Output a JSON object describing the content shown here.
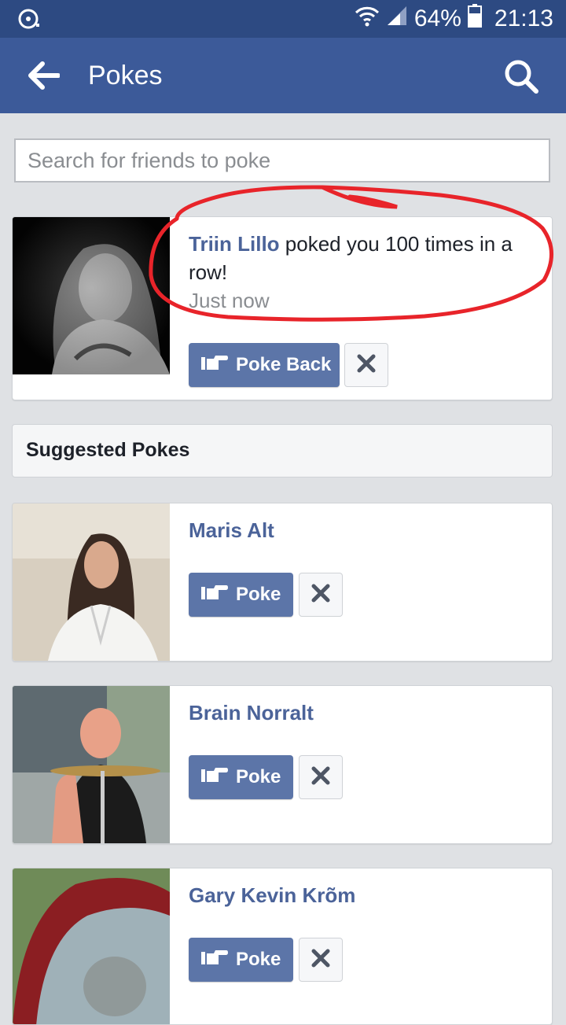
{
  "status_bar": {
    "battery": "64%",
    "time": "21:13"
  },
  "header": {
    "title": "Pokes"
  },
  "search": {
    "placeholder": "Search for friends to poke"
  },
  "poke_received": {
    "name": "Triin Lillo",
    "message": " poked you 100 times in a row!",
    "time": "Just now",
    "poke_back_label": "Poke Back"
  },
  "suggested": {
    "heading": "Suggested Pokes",
    "poke_label": "Poke",
    "items": [
      {
        "name": "Maris Alt"
      },
      {
        "name": "Brain Norralt"
      },
      {
        "name": "Gary Kevin Krõm"
      }
    ]
  },
  "colors": {
    "brand": "#3c5a99",
    "status_bar": "#2d4a82",
    "button": "#5c75a8",
    "annotation": "#e8242a"
  }
}
